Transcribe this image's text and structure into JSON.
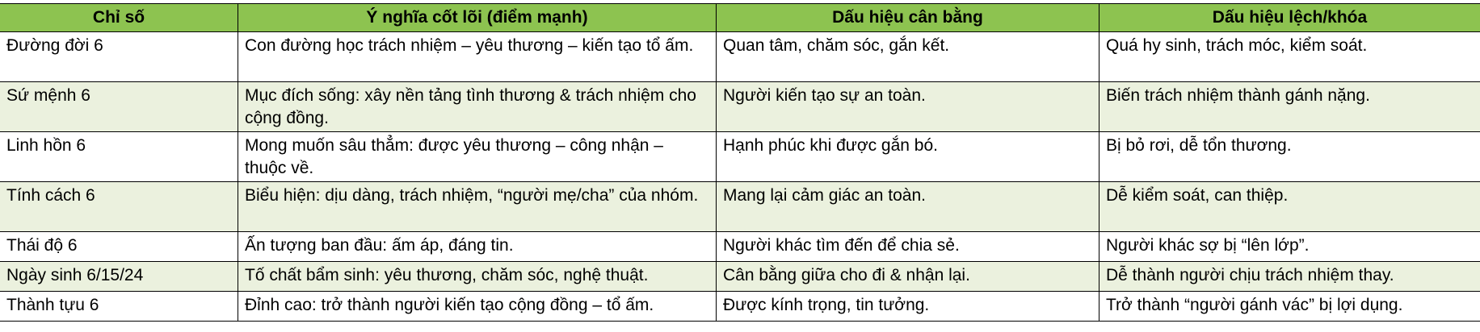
{
  "table": {
    "headers": [
      "Chỉ số",
      "Ý nghĩa cốt lõi (điểm mạnh)",
      "Dấu hiệu cân bằng",
      "Dấu hiệu lệch/khóa"
    ],
    "rows": [
      [
        "Đường đời 6",
        "Con đường học trách nhiệm – yêu thương – kiến tạo tổ ấm.",
        "Quan tâm, chăm sóc, gắn kết.",
        "Quá hy sinh, trách móc, kiểm soát."
      ],
      [
        "Sứ mệnh 6",
        "Mục đích sống: xây nền tảng tình thương & trách nhiệm cho cộng đồng.",
        "Người kiến tạo sự an toàn.",
        "Biến trách nhiệm thành gánh nặng."
      ],
      [
        "Linh hồn 6",
        "Mong muốn sâu thẳm: được yêu thương – công nhận – thuộc về.",
        "Hạnh phúc khi được gắn bó.",
        "Bị bỏ rơi, dễ tổn thương."
      ],
      [
        "Tính cách 6",
        "Biểu hiện: dịu dàng, trách nhiệm, “người mẹ/cha” của nhóm.",
        "Mang lại cảm giác an toàn.",
        "Dễ kiểm soát, can thiệp."
      ],
      [
        "Thái độ 6",
        "Ấn tượng ban đầu: ấm áp, đáng tin.",
        "Người khác tìm đến để chia sẻ.",
        "Người khác sợ bị “lên lớp”."
      ],
      [
        "Ngày sinh 6/15/24",
        "Tố chất bẩm sinh: yêu thương, chăm sóc, nghệ thuật.",
        "Cân bằng giữa cho đi & nhận lại.",
        "Dễ thành người chịu trách nhiệm thay."
      ],
      [
        "Thành tựu 6",
        "Đỉnh cao: trở thành người kiến tạo cộng đồng – tổ ấm.",
        "Được kính trọng, tin tưởng.",
        "Trở thành “người gánh vác” bị lợi dụng."
      ]
    ]
  },
  "colors": {
    "header_bg": "#8dc350",
    "alt_row_bg": "#ebf1de",
    "row_bg": "#ffffff",
    "border": "#000000"
  }
}
